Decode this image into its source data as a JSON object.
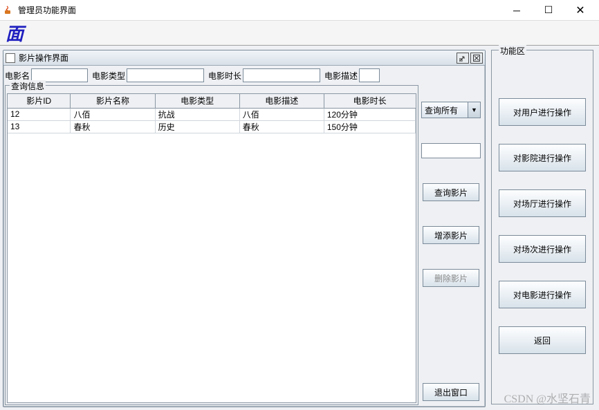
{
  "window": {
    "title": "管理员功能界面",
    "logo": "面"
  },
  "internal_frame": {
    "title": "影片操作界面"
  },
  "form": {
    "name_label": "电影名",
    "type_label": "电影类型",
    "duration_label": "电影时长",
    "desc_label": "电影描述",
    "name_value": "",
    "type_value": "",
    "duration_value": "",
    "desc_value": ""
  },
  "query_fieldset_legend": "查询信息",
  "table": {
    "headers": [
      "影片ID",
      "影片名称",
      "电影类型",
      "电影描述",
      "电影时长"
    ],
    "rows": [
      [
        "12",
        "八佰",
        "抗战",
        "八佰",
        "120分钟"
      ],
      [
        "13",
        "春秋",
        "历史",
        "春秋",
        "150分钟"
      ]
    ]
  },
  "side": {
    "combo_value": "查询所有",
    "search_input": "",
    "query_btn": "查询影片",
    "add_btn": "增添影片",
    "delete_btn": "删除影片",
    "exit_btn": "退出窗口"
  },
  "func": {
    "legend": "功能区",
    "buttons": [
      "对用户进行操作",
      "对影院进行操作",
      "对场厅进行操作",
      "对场次进行操作",
      "对电影进行操作",
      "返回"
    ]
  },
  "watermark": "CSDN @水坚石青"
}
